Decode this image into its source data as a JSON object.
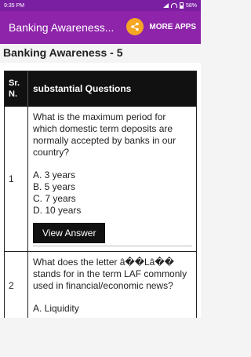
{
  "statusbar": {
    "time": "9:35 PM",
    "battery": "58%"
  },
  "appbar": {
    "title": "Banking Awareness...",
    "more_apps": "MORE APPS"
  },
  "page_heading": "Banking Awareness - 5",
  "table": {
    "headers": {
      "sr": "Sr. N.",
      "questions": "substantial Questions"
    },
    "rows": [
      {
        "sr": "1",
        "question": "What is the maximum period for which domestic term deposits are normally accepted by banks in our country?",
        "options": [
          "A. 3 years",
          "B. 5 years",
          "C. 7 years",
          "D. 10 years"
        ],
        "button": "View Answer"
      },
      {
        "sr": "2",
        "question": "What does the letter â��Lâ�� stands for in the term LAF commonly used in financial/economic news?",
        "options": [
          "A. Liquidity"
        ]
      }
    ]
  },
  "colors": {
    "statusbar": "#7b1fa2",
    "appbar": "#8e24aa",
    "share": "#f5a623",
    "header": "#111111"
  }
}
